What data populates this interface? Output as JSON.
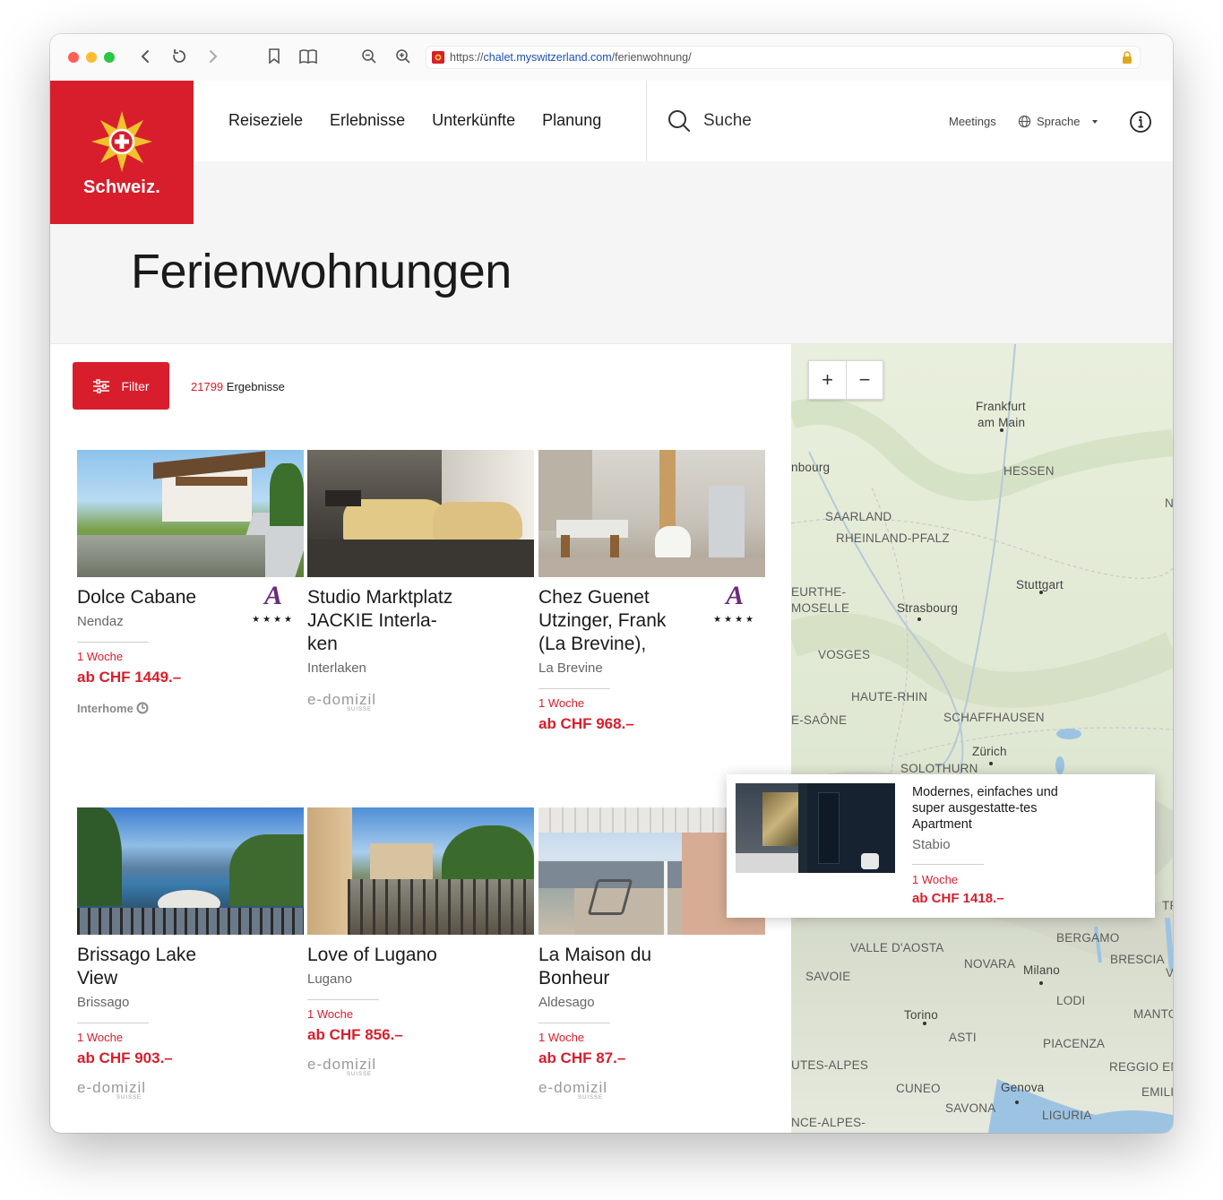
{
  "browser": {
    "url_prefix": "https://",
    "url_host": "chalet.myswitzerland.com",
    "url_path": "/ferienwohnung/"
  },
  "header": {
    "logo_text": "Schweiz.",
    "nav": [
      "Reiseziele",
      "Erlebnisse",
      "Unterkünfte",
      "Planung"
    ],
    "search_label": "Suche",
    "meetings_label": "Meetings",
    "language_label": "Sprache"
  },
  "page": {
    "title": "Ferienwohnungen",
    "filter_label": "Filter",
    "result_count": "21799",
    "result_label": "Ergebnisse"
  },
  "listings": [
    {
      "name": "Dolce Cabane",
      "place": "Nendaz",
      "duration": "1 Woche",
      "price": "ab CHF 1449.–",
      "brand": "Interhome",
      "rating_stars": "★★★★",
      "rating_mark": "A"
    },
    {
      "name": "Studio Marktplatz JACKIE Interla-ken",
      "place": "Interlaken",
      "duration": "",
      "price": "",
      "brand": "e-domizil",
      "brand_sub": "SUISSE"
    },
    {
      "name": "Chez Guenet Utzinger, Frank (La Brevine),",
      "place": "La Brevine",
      "duration": "1 Woche",
      "price": "ab CHF 968.–",
      "brand": "",
      "rating_stars": "★★★★",
      "rating_mark": "A"
    },
    {
      "name": "Brissago Lake View",
      "place": "Brissago",
      "duration": "1 Woche",
      "price": "ab CHF 903.–",
      "brand": "e-domizil",
      "brand_sub": "SUISSE"
    },
    {
      "name": "Love of Lugano",
      "place": "Lugano",
      "duration": "1 Woche",
      "price": "ab CHF 856.–",
      "brand": "e-domizil",
      "brand_sub": "SUISSE"
    },
    {
      "name": "La Maison du Bonheur",
      "place": "Aldesago",
      "duration": "1 Woche",
      "price": "ab CHF 87.–",
      "brand": "e-domizil",
      "brand_sub": "SUISSE"
    }
  ],
  "map": {
    "labels": [
      "Frankfurt",
      "am Main",
      "nbourg",
      "HESSEN",
      "SAARLAND",
      "RHEINLAND-PFALZ",
      "Stuttgart",
      "EURTHE-",
      "MOSELLE",
      "Strasbourg",
      "VOSGES",
      "HAUTE-RHIN",
      "E-SAÔNE",
      "SCHAFFHAUSEN",
      "Zürich",
      "SOLOTHURN",
      "VALLE D'AOSTA",
      "BERGAMO",
      "NOVARA",
      "Milano",
      "BRESCIA",
      "SAVOIE",
      "LODI",
      "Torino",
      "ASTI",
      "PIACENZA",
      "MANTO",
      "UTES-ALPES",
      "REGGIO EM",
      "CUNEO",
      "Genova",
      "EMILI",
      "SAVONA",
      "LIGURIA",
      "NCE-ALPES-",
      "N",
      "TR",
      "V"
    ],
    "zoom_in": "+",
    "zoom_out": "−",
    "popup": {
      "title": "Modernes, einfaches und super ausgestatte-tes Apartment",
      "place": "Stabio",
      "duration": "1 Woche",
      "price": "ab CHF 1418.–"
    }
  }
}
